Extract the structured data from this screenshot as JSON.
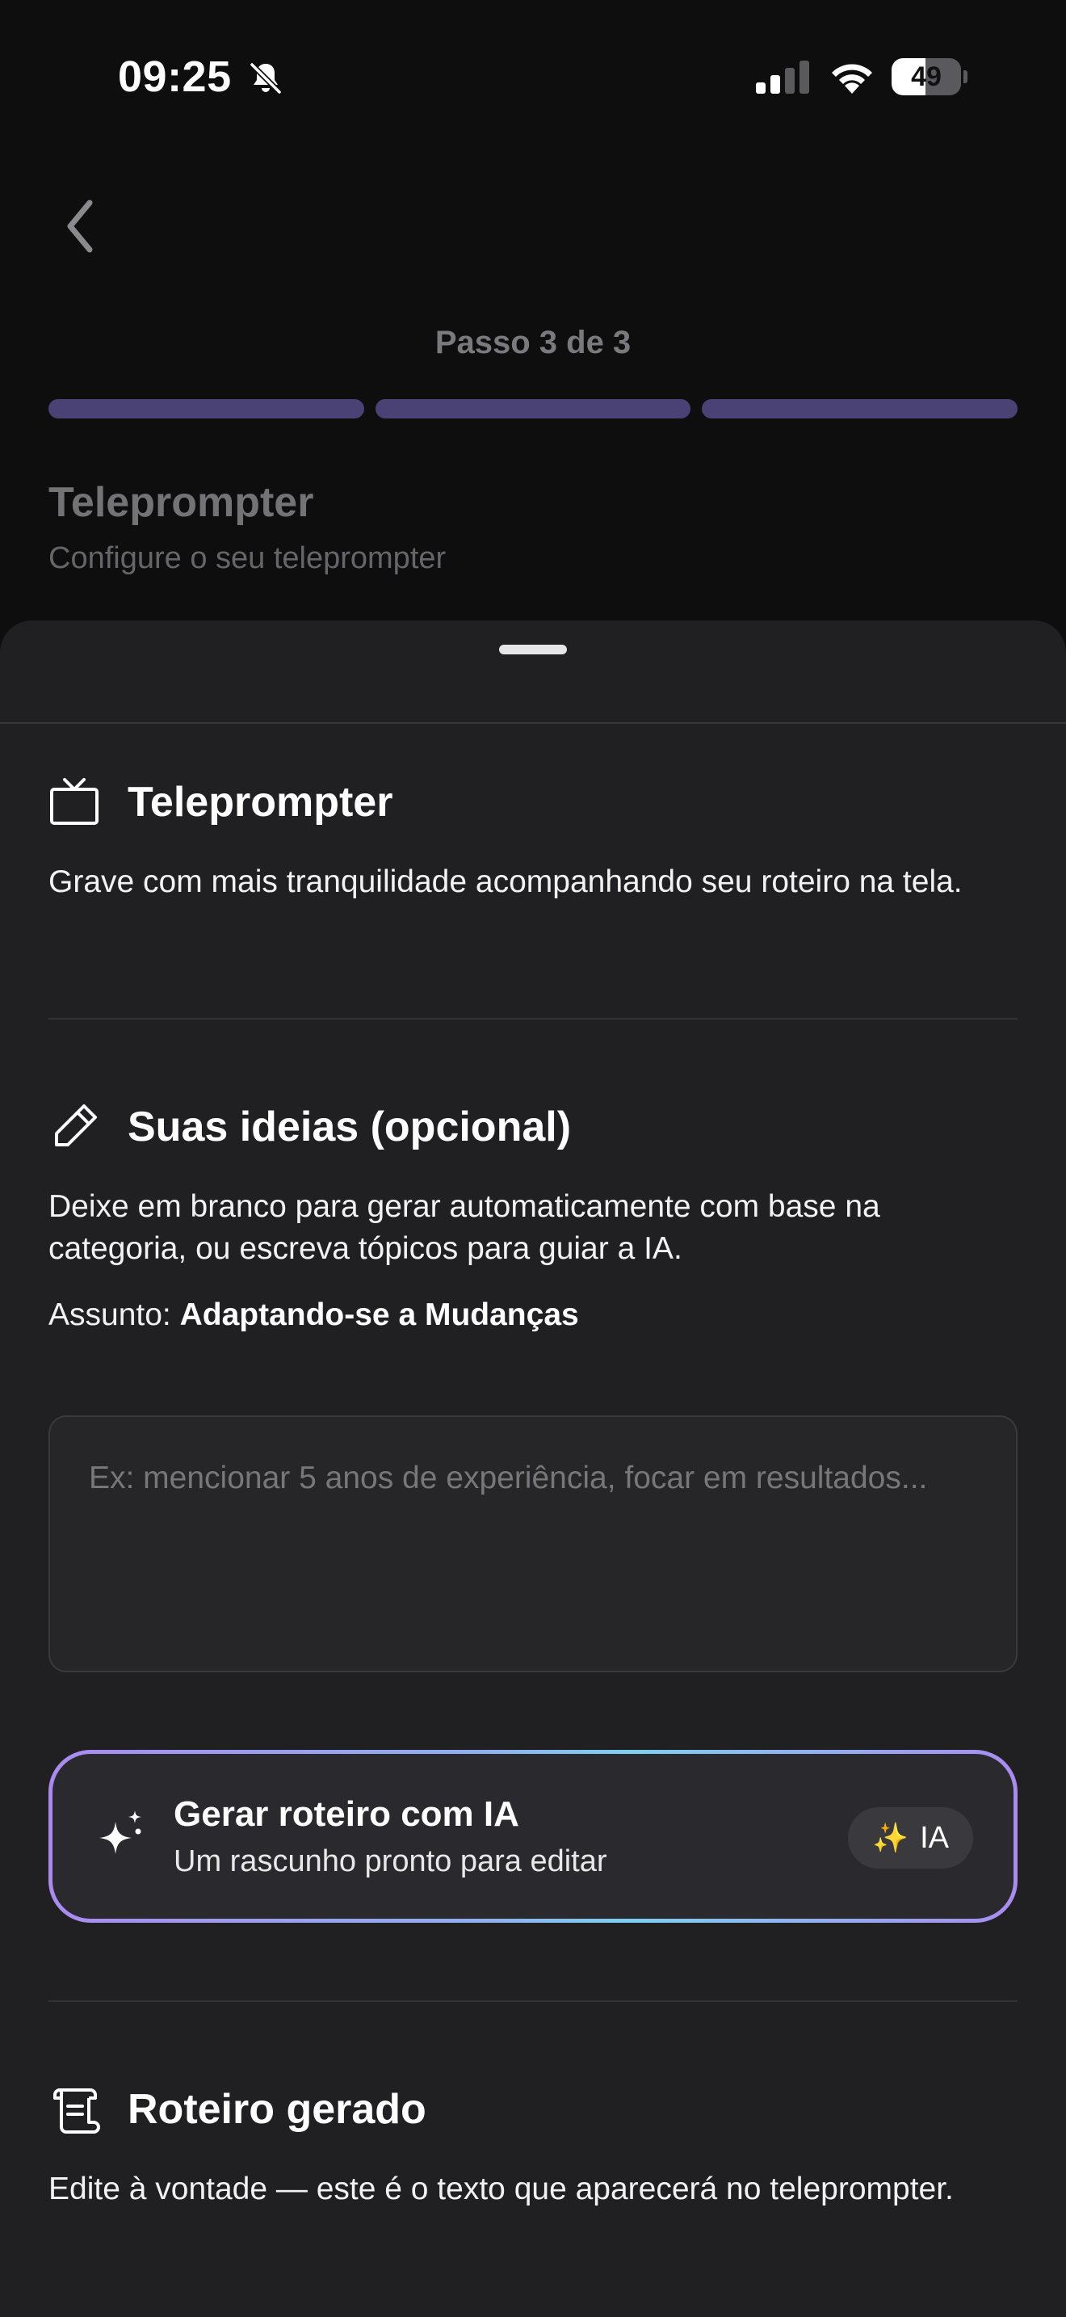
{
  "status_bar": {
    "time": "09:25",
    "battery": "49",
    "battery_level": 0.49
  },
  "header": {
    "step": "Passo 3 de 3",
    "steps_total": 3,
    "steps_completed": 3,
    "progress_color": "#4a4275",
    "title": "Teleprompter",
    "subtitle": "Configure o seu teleprompter"
  },
  "sections": {
    "teleprompter": {
      "icon": "tv-icon",
      "title": "Teleprompter",
      "description": "Grave com mais tranquilidade acompanhando seu roteiro na tela."
    },
    "ideas": {
      "icon": "pencil-icon",
      "title": "Suas ideias (opcional)",
      "description": "Deixe em branco para gerar automaticamente com base na categoria, ou escreva tópicos para guiar a IA.",
      "subject_label": "Assunto:",
      "subject_value": "Adaptando-se a Mudanças",
      "placeholder": "Ex: mencionar 5 anos de experiência, focar em resultados...",
      "value": ""
    },
    "ai_generate": {
      "icon": "sparkles-icon",
      "title": "Gerar roteiro com IA",
      "subtitle": "Um rascunho pronto para editar",
      "badge_icon": "✨",
      "badge_label": "IA"
    },
    "script": {
      "icon": "scroll-icon",
      "title": "Roteiro gerado",
      "description": "Edite à vontade — este é o texto que aparecerá no teleprompter."
    }
  },
  "colors": {
    "background": "#0e0e0f",
    "sheet": "#202022",
    "accent_gradient_start": "#a98bf0",
    "accent_gradient_mid": "#7dd0f0"
  }
}
